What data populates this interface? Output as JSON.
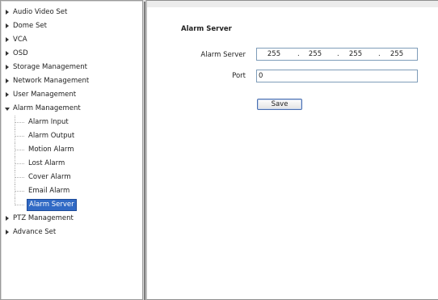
{
  "sidebar": {
    "items": [
      {
        "label": "Audio Video Set",
        "expanded": false
      },
      {
        "label": "Dome Set",
        "expanded": false
      },
      {
        "label": "VCA",
        "expanded": false
      },
      {
        "label": "OSD",
        "expanded": false
      },
      {
        "label": "Storage Management",
        "expanded": false
      },
      {
        "label": "Network Management",
        "expanded": false
      },
      {
        "label": "User Management",
        "expanded": false
      },
      {
        "label": "Alarm Management",
        "expanded": true
      },
      {
        "label": "PTZ Management",
        "expanded": false
      },
      {
        "label": "Advance Set",
        "expanded": false
      }
    ],
    "alarm_children": [
      {
        "label": "Alarm Input"
      },
      {
        "label": "Alarm Output"
      },
      {
        "label": "Motion Alarm"
      },
      {
        "label": "Lost Alarm"
      },
      {
        "label": "Cover Alarm"
      },
      {
        "label": "Email Alarm"
      },
      {
        "label": "Alarm Server",
        "selected": true
      }
    ]
  },
  "main": {
    "section_title": "Alarm Server",
    "alarm_server_label": "Alarm Server",
    "ip": [
      "255",
      "255",
      "255",
      "255"
    ],
    "ip_separator": ".",
    "port_label": "Port",
    "port_value": "0",
    "save_label": "Save"
  },
  "colors": {
    "selection": "#316ac5",
    "input_border": "#7f9db9"
  }
}
